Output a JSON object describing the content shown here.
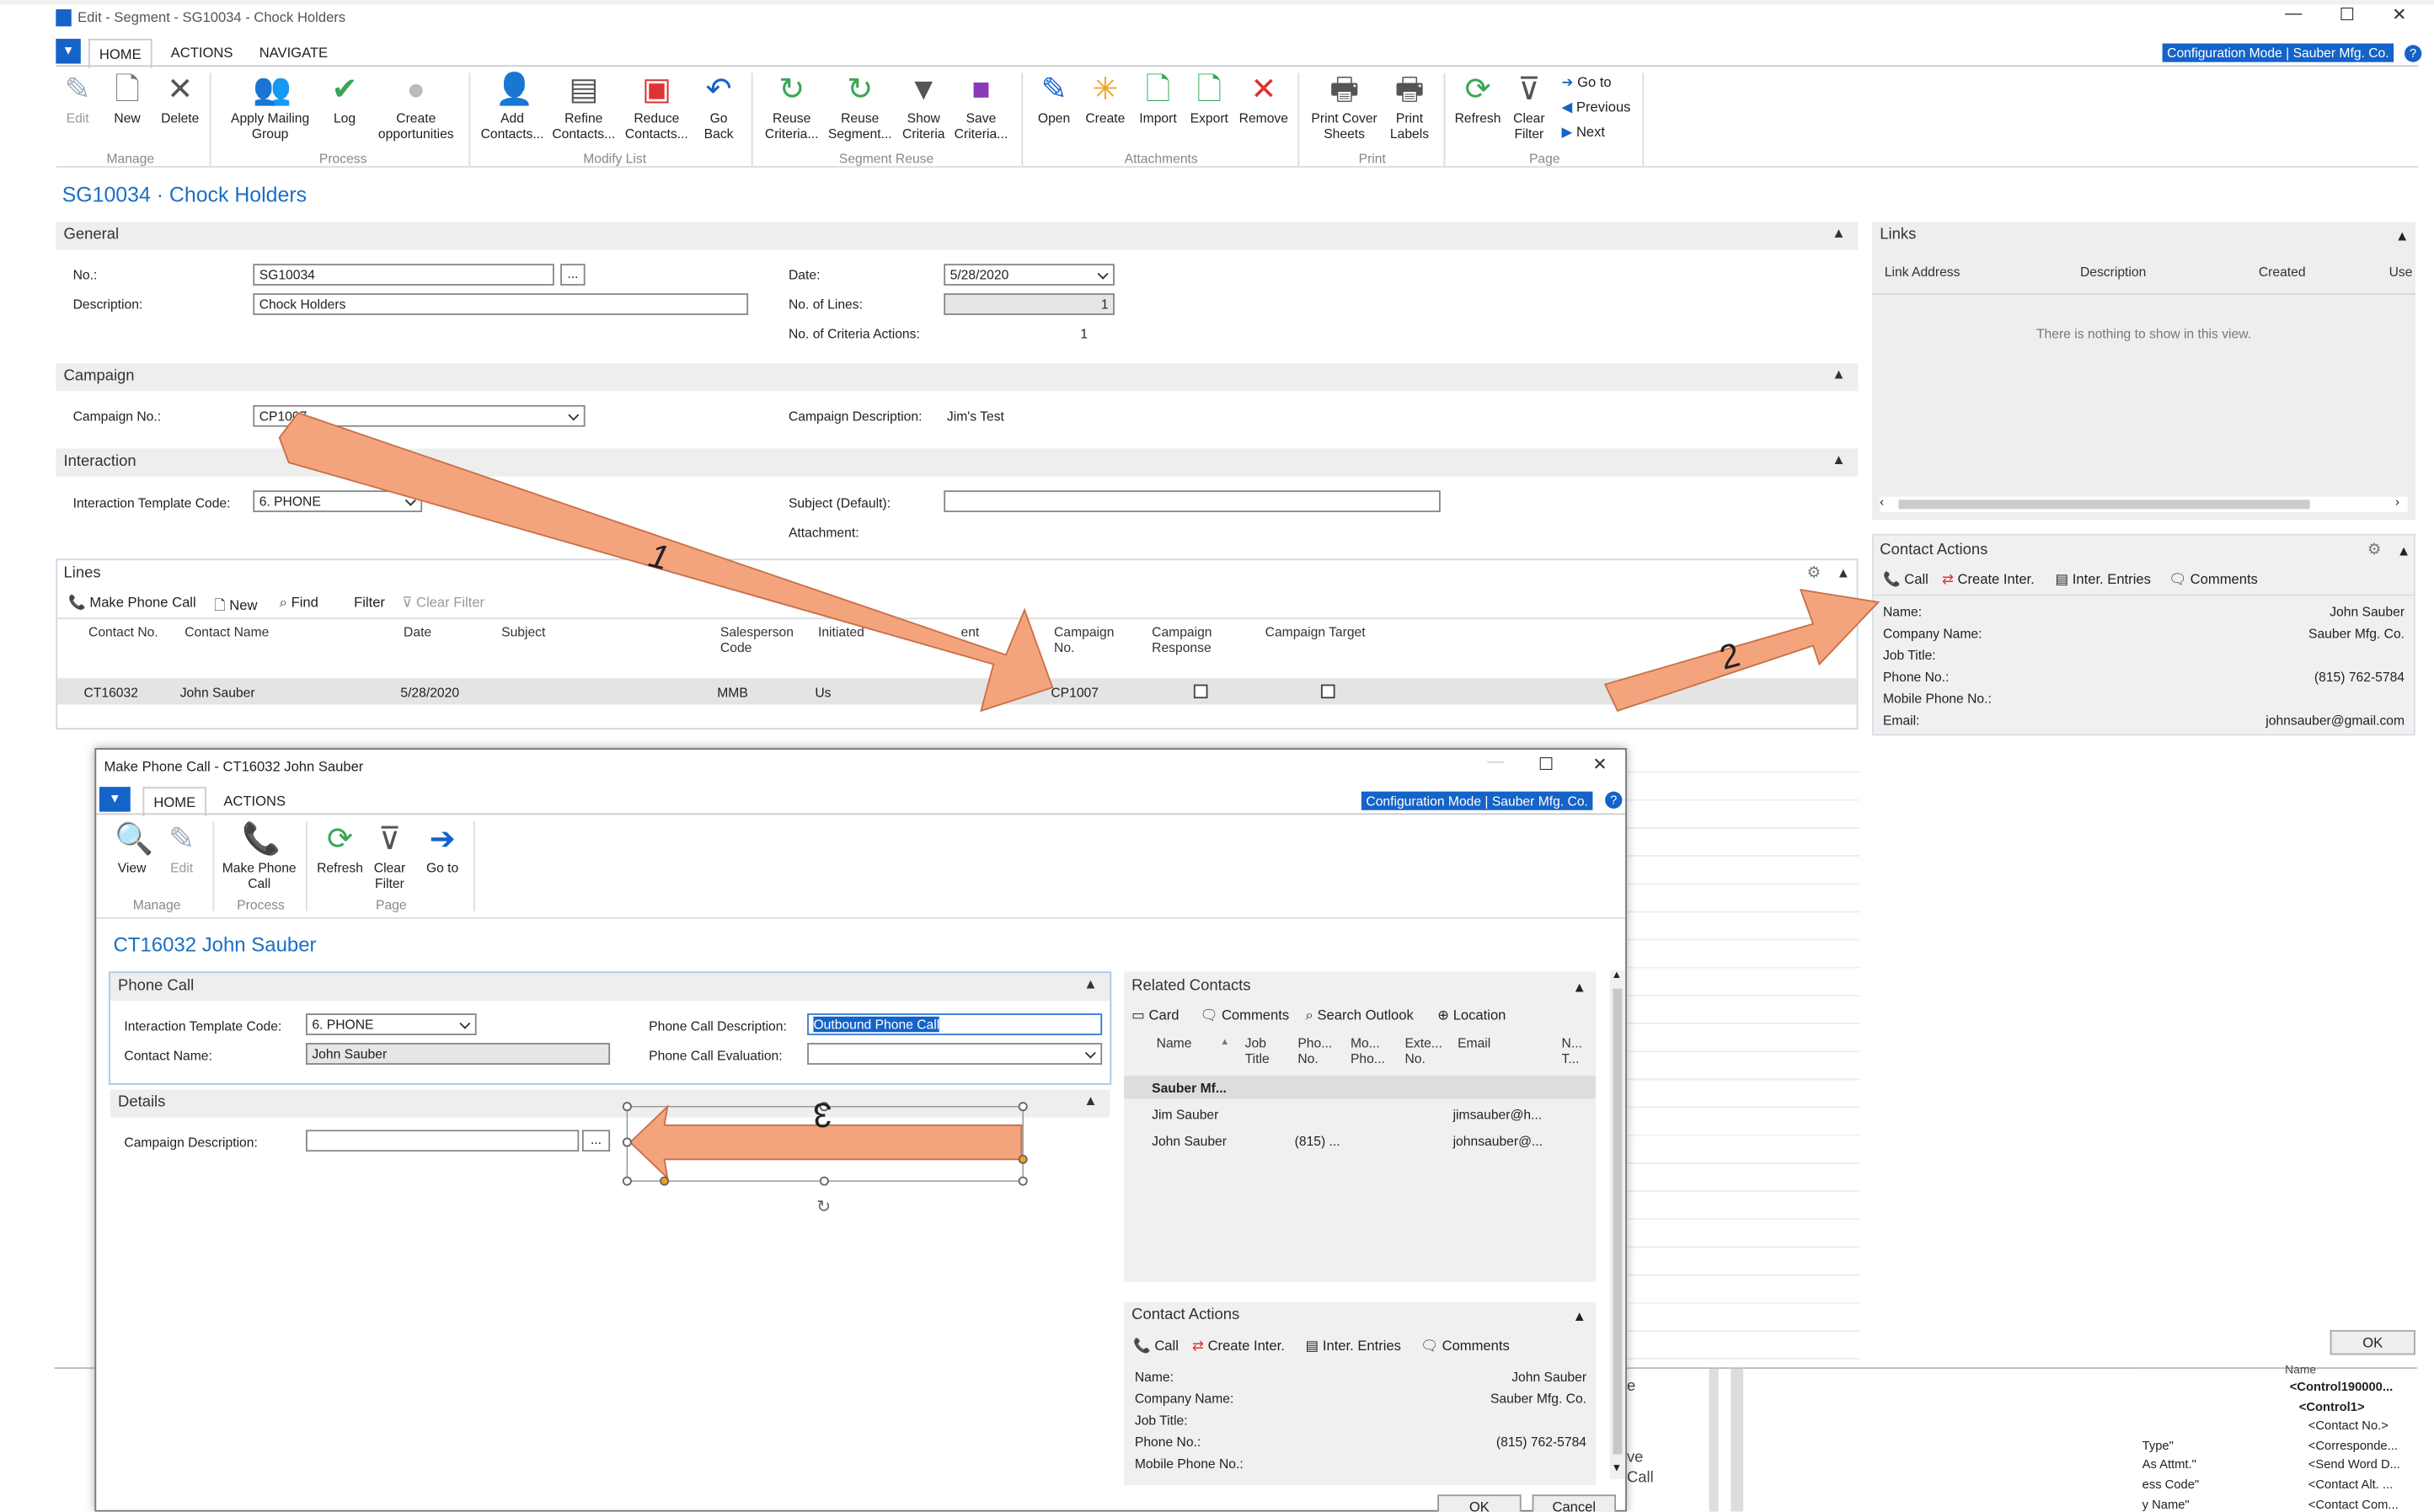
{
  "window": {
    "title": "Edit - Segment - SG10034 - Chock Holders",
    "config_badge": "Configuration Mode | Sauber Mfg. Co."
  },
  "tabs": [
    "HOME",
    "ACTIONS",
    "NAVIGATE"
  ],
  "ribbon": {
    "groups": [
      {
        "name": "Manage",
        "buttons": [
          "Edit",
          "New",
          "Delete"
        ]
      },
      {
        "name": "Process",
        "buttons": [
          "Apply Mailing Group",
          "Log",
          "Create opportunities"
        ]
      },
      {
        "name": "Modify List",
        "buttons": [
          "Add Contacts...",
          "Refine Contacts...",
          "Reduce Contacts...",
          "Go Back"
        ]
      },
      {
        "name": "Segment Reuse",
        "buttons": [
          "Reuse Criteria...",
          "Reuse Segment...",
          "Show Criteria",
          "Save Criteria..."
        ]
      },
      {
        "name": "Attachments",
        "buttons": [
          "Open",
          "Create",
          "Import",
          "Export",
          "Remove"
        ]
      },
      {
        "name": "Print",
        "buttons": [
          "Print Cover Sheets",
          "Print Labels"
        ]
      },
      {
        "name": "Page",
        "buttons": [
          "Refresh",
          "Clear Filter"
        ],
        "nav": [
          "Go to",
          "Previous",
          "Next"
        ]
      }
    ]
  },
  "page_title": "SG10034 · Chock Holders",
  "general": {
    "header": "General",
    "no_label": "No.:",
    "no_value": "SG10034",
    "desc_label": "Description:",
    "desc_value": "Chock Holders",
    "date_label": "Date:",
    "date_value": "5/28/2020",
    "lines_label": "No. of Lines:",
    "lines_value": "1",
    "criteria_label": "No. of Criteria Actions:",
    "criteria_value": "1"
  },
  "campaign": {
    "header": "Campaign",
    "no_label": "Campaign No.:",
    "no_value": "CP1007",
    "desc_label": "Campaign Description:",
    "desc_value": "Jim's Test"
  },
  "interaction": {
    "header": "Interaction",
    "tmpl_label": "Interaction Template Code:",
    "tmpl_value": "6. PHONE",
    "subject_label": "Subject (Default):",
    "attach_label": "Attachment:"
  },
  "lines": {
    "header": "Lines",
    "toolbar": [
      "Make Phone Call",
      "New",
      "Find",
      "Filter",
      "Clear Filter"
    ],
    "columns": [
      "Contact No.",
      "Contact Name",
      "Date",
      "Subject",
      "Salesperson Code",
      "Initiated",
      "ent",
      "Campaign No.",
      "Campaign Response",
      "Campaign Target"
    ],
    "row": {
      "contact_no": "CT16032",
      "contact_name": "John Sauber",
      "date": "5/28/2020",
      "salesperson": "MMB",
      "initiated": "Us",
      "campaign_no": "CP1007"
    }
  },
  "links": {
    "header": "Links",
    "columns": [
      "Link Address",
      "Description",
      "Created",
      "Use"
    ],
    "empty": "There is nothing to show in this view."
  },
  "contact_actions": {
    "header": "Contact Actions",
    "toolbar": [
      "Call",
      "Create Inter.",
      "Inter. Entries",
      "Comments"
    ],
    "fields": [
      {
        "label": "Name:",
        "value": "John Sauber"
      },
      {
        "label": "Company Name:",
        "value": "Sauber Mfg. Co."
      },
      {
        "label": "Job Title:",
        "value": ""
      },
      {
        "label": "Phone No.:",
        "value": "(815) 762-5784"
      },
      {
        "label": "Mobile Phone No.:",
        "value": ""
      },
      {
        "label": "Email:",
        "value": "johnsauber@gmail.com"
      }
    ]
  },
  "ok_label": "OK",
  "annotations": [
    "1",
    "2",
    "3"
  ],
  "dialog": {
    "title": "Make Phone Call - CT16032 John Sauber",
    "config_badge": "Configuration Mode | Sauber Mfg. Co.",
    "tabs": [
      "HOME",
      "ACTIONS"
    ],
    "ribbon": [
      {
        "name": "Manage",
        "buttons": [
          "View",
          "Edit"
        ]
      },
      {
        "name": "Process",
        "buttons": [
          "Make Phone Call"
        ]
      },
      {
        "name": "Page",
        "buttons": [
          "Refresh",
          "Clear Filter",
          "Go to"
        ]
      }
    ],
    "page_title": "CT16032 John Sauber",
    "phone_call": {
      "header": "Phone Call",
      "tmpl_label": "Interaction Template Code:",
      "tmpl_value": "6. PHONE",
      "name_label": "Contact Name:",
      "name_value": "John Sauber",
      "desc_label": "Phone Call Description:",
      "desc_value": "Outbound Phone Call",
      "eval_label": "Phone Call Evaluation:"
    },
    "details": {
      "header": "Details",
      "camp_desc_label": "Campaign Description:"
    },
    "related": {
      "header": "Related Contacts",
      "toolbar": [
        "Card",
        "Comments",
        "Search Outlook",
        "Location"
      ],
      "columns": [
        "Name",
        "Job Title",
        "Pho... No.",
        "Mo... Pho...",
        "Exte... No.",
        "Email",
        "N... T..."
      ],
      "rows": [
        {
          "name": "Sauber Mf...",
          "phone": "",
          "email": ""
        },
        {
          "name": "Jim Sauber",
          "phone": "",
          "email": "jimsauber@h..."
        },
        {
          "name": "John Sauber",
          "phone": "(815) ...",
          "email": "johnsauber@..."
        }
      ]
    },
    "contact_actions": {
      "header": "Contact Actions",
      "toolbar": [
        "Call",
        "Create Inter.",
        "Inter. Entries",
        "Comments"
      ],
      "fields": [
        {
          "label": "Name:",
          "value": "John Sauber"
        },
        {
          "label": "Company Name:",
          "value": "Sauber Mfg. Co."
        },
        {
          "label": "Job Title:",
          "value": ""
        },
        {
          "label": "Phone No.:",
          "value": "(815) 762-5784"
        },
        {
          "label": "Mobile Phone No.:",
          "value": ""
        }
      ]
    },
    "ok": "OK",
    "cancel": "Cancel"
  },
  "background_text": {
    "right_col": [
      "Name",
      "<Control190000...",
      "<Control1>",
      "<Contact No.>",
      "<Corresponde...",
      "<Send Word D...",
      "<Contact Alt. ...",
      "<Contact Com..."
    ],
    "mid_col": [
      "Type\"",
      "As Attmt.\"",
      "ess Code\"",
      "y Name\""
    ],
    "left_frag": [
      "e",
      "ve",
      "Call"
    ]
  },
  "colors": {
    "accent": "#1463c8",
    "link": "#1a6fc4",
    "arrow": "#f4a47c"
  }
}
